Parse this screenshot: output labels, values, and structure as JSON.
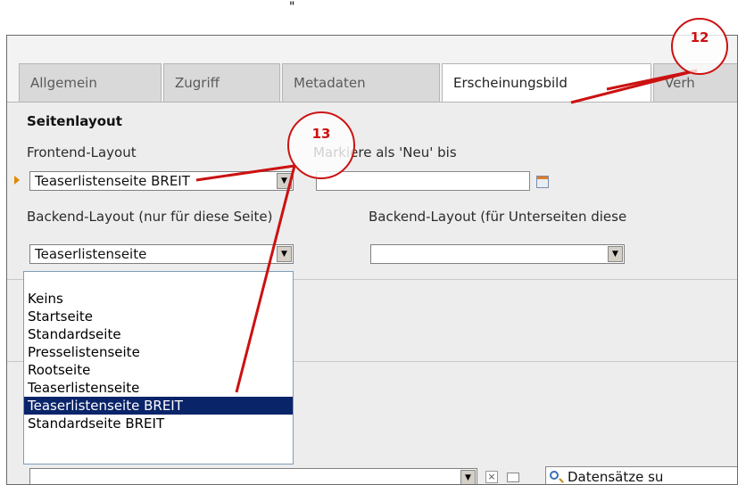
{
  "top_caret": "\"",
  "tabs": [
    {
      "label": "Allgemein",
      "active": false
    },
    {
      "label": "Zugriff",
      "active": false
    },
    {
      "label": "Metadaten",
      "active": false
    },
    {
      "label": "Erscheinungsbild",
      "active": true
    },
    {
      "label": "Verh",
      "active": false
    }
  ],
  "section_title": "Seitenlayout",
  "frontend_layout": {
    "label": "Frontend-Layout",
    "value": "Teaserlistenseite BREIT"
  },
  "new_until": {
    "label": "Markiere als 'Neu' bis",
    "value": ""
  },
  "backend_layout_page": {
    "label": "Backend-Layout (nur für diese Seite)",
    "value": "Teaserlistenseite"
  },
  "backend_layout_subpages": {
    "label": "Backend-Layout (für Unterseiten diese",
    "value": ""
  },
  "dropdown_options": [
    {
      "label": "Keins",
      "selected": false
    },
    {
      "label": "Startseite",
      "selected": false
    },
    {
      "label": "Standardseite",
      "selected": false
    },
    {
      "label": "Presselistenseite",
      "selected": false
    },
    {
      "label": "Rootseite",
      "selected": false
    },
    {
      "label": "Teaserlistenseite",
      "selected": false
    },
    {
      "label": "Teaserlistenseite BREIT",
      "selected": true
    },
    {
      "label": "Standardseite BREIT",
      "selected": false
    }
  ],
  "bottom_select": {
    "value": ""
  },
  "search": {
    "label": "Datensätze su"
  },
  "callouts": {
    "c12": "12",
    "c13": "13"
  },
  "colors": {
    "callout": "#cc1111",
    "selection": "#0a246a",
    "marker": "#e28a00"
  }
}
